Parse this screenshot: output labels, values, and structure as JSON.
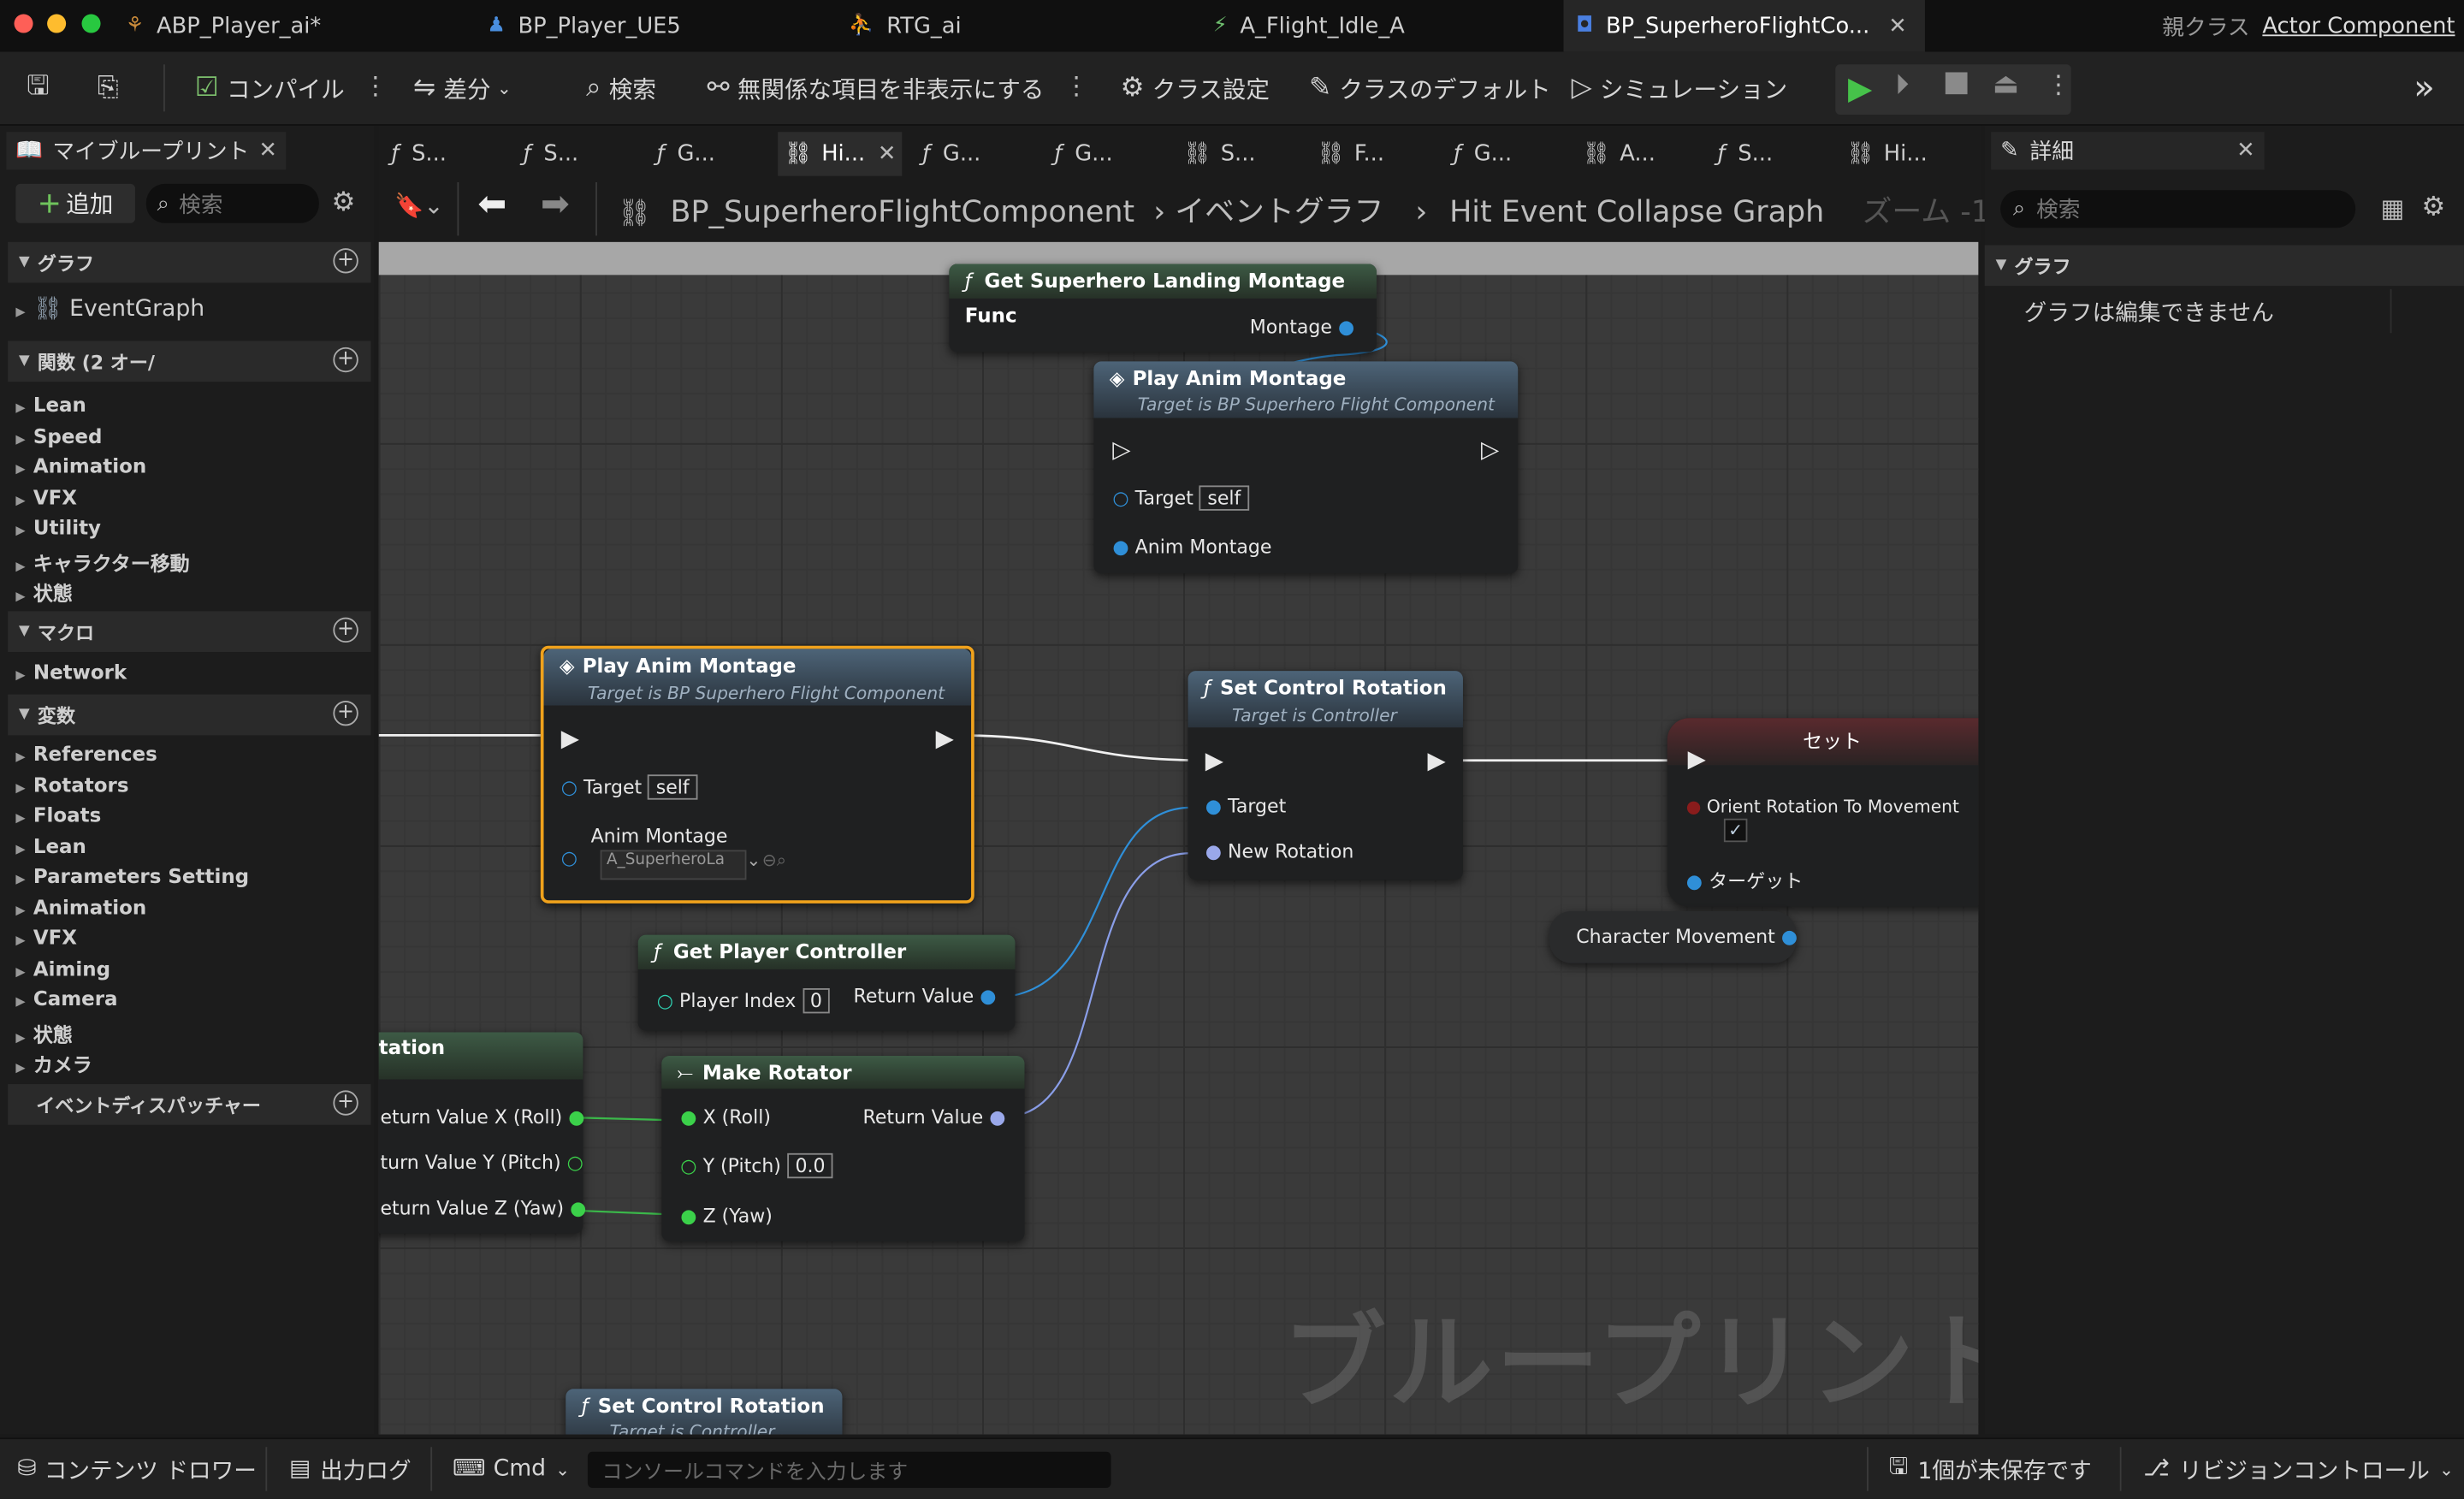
{
  "window": {
    "tabs": [
      {
        "label": "ABP_Player_ai*",
        "icon": "anim-blueprint-icon"
      },
      {
        "label": "BP_Player_UE5",
        "icon": "character-blueprint-icon"
      },
      {
        "label": "RTG_ai",
        "icon": "retarget-icon"
      },
      {
        "label": "A_Flight_Idle_A",
        "icon": "animation-icon"
      },
      {
        "label": "BP_SuperheroFlightCo...",
        "icon": "component-blueprint-icon"
      }
    ],
    "parent_class_label": "親クラス",
    "parent_class_value": "Actor Component"
  },
  "toolbar": {
    "compile": "コンパイル",
    "diff": "差分",
    "search": "検索",
    "hide_unrelated": "無関係な項目を非表示にする",
    "class_settings": "クラス設定",
    "class_defaults": "クラスのデフォルト",
    "simulation": "シミュレーション"
  },
  "left_panel": {
    "tab": "マイブループリント",
    "add": "追加",
    "search_placeholder": "検索",
    "graphs_header": "グラフ",
    "graphs": [
      "EventGraph"
    ],
    "functions_header": "関数 (2 オー/",
    "functions": [
      "Lean",
      "Speed",
      "Animation",
      "VFX",
      "Utility",
      "キャラクター移動",
      "状態"
    ],
    "macros_header": "マクロ",
    "macros": [
      "Network"
    ],
    "variables_header": "変数",
    "variables": [
      "References",
      "Rotators",
      "Floats",
      "Lean",
      "Parameters Setting",
      "Animation",
      "VFX",
      "Aiming",
      "Camera",
      "状態",
      "カメラ"
    ],
    "dispatchers_header": "イベントディスパッチャー"
  },
  "graph": {
    "tabs": [
      "S...",
      "S...",
      "G...",
      "Hi...",
      "G...",
      "G...",
      "S...",
      "F...",
      "G...",
      "A...",
      "S...",
      "Hi..."
    ],
    "breadcrumb_asset": "BP_SuperheroFlightComponent",
    "breadcrumb_graph": "イベントグラフ",
    "breadcrumb_current": "Hit Event Collapse Graph",
    "zoom": "ズーム -1",
    "watermark": "ブループリント",
    "nodes": {
      "get_landing": {
        "title": "Get Superhero Landing Montage Func",
        "out": "Montage"
      },
      "play_top": {
        "title": "Play Anim Montage",
        "sub": "Target is BP Superhero Flight Component",
        "target": "Target",
        "self": "self",
        "anim": "Anim Montage"
      },
      "play_sel": {
        "title": "Play Anim Montage",
        "sub": "Target is BP Superhero Flight Component",
        "target": "Target",
        "self": "self",
        "anim": "Anim Montage",
        "anim_value": "A_SuperheroLa"
      },
      "set_rot": {
        "title": "Set Control Rotation",
        "sub": "Target is Controller",
        "target": "Target",
        "new_rot": "New Rotation"
      },
      "set_var": {
        "title": "セット",
        "orient": "Orient Rotation To Movement",
        "target": "ターゲット"
      },
      "char_move": {
        "label": "Character Movement"
      },
      "get_pc": {
        "title": "Get Player Controller",
        "idx": "Player Index",
        "idx_val": "0",
        "ret": "Return Value"
      },
      "partial": {
        "title": "tation",
        "x": "eturn Value X (Roll)",
        "y": "turn Value Y (Pitch)",
        "z": "eturn Value Z (Yaw)"
      },
      "make_rot": {
        "title": "Make Rotator",
        "x": "X (Roll)",
        "y": "Y (Pitch)",
        "y_val": "0.0",
        "z": "Z (Yaw)",
        "ret": "Return Value"
      },
      "set_rot_bottom": {
        "title": "Set Control Rotation",
        "sub": "Target is Controller"
      }
    }
  },
  "right_panel": {
    "tab": "詳細",
    "search_placeholder": "検索",
    "section": "グラフ",
    "message": "グラフは編集できません"
  },
  "status_bar": {
    "content_drawer": "コンテンツ ドロワー",
    "output_log": "出力ログ",
    "cmd": "Cmd",
    "console_placeholder": "コンソールコマンドを入力します",
    "unsaved": "1個が未保存です",
    "revision": "リビジョンコントロール"
  }
}
